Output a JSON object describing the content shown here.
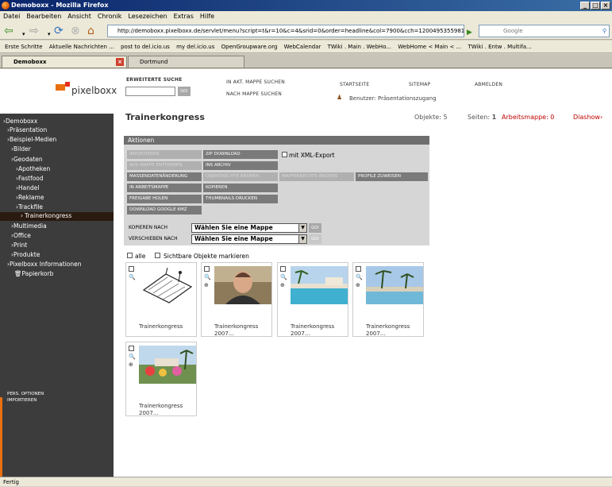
{
  "window": {
    "title": "Demoboxx - Mozilla Firefox"
  },
  "menu": [
    "Datei",
    "Bearbeiten",
    "Ansicht",
    "Chronik",
    "Lesezeichen",
    "Extras",
    "Hilfe"
  ],
  "nav": {
    "url": "http://demoboxx.pixelboxx.de/servlet/menu?script=t&r=10&c=4&srid=0&order=headline&col=7900&cch=1200495355981&JServSessionIdroot=2",
    "search_placeholder": "Google"
  },
  "bookmarks": [
    "Erste Schritte",
    "Aktuelle Nachrichten ...",
    "post to del.icio.us",
    "my del.icio.us",
    "OpenGroupware.org",
    "WebCalendar",
    "TWiki . Main . WebHo...",
    "WebHome < Main < ...",
    "TWiki . Entw . Multifa..."
  ],
  "tabs": [
    "Demoboxx",
    "Dortmund"
  ],
  "header": {
    "logo": "pixelboxx",
    "search_title": "ERWEITERTE SUCHE",
    "go": "GO!",
    "in_mappe": "IN AKT. MAPPE SUCHEN",
    "nach_mappe": "NACH MAPPE SUCHEN",
    "startseite": "STARTSEITE",
    "sitemap": "SITEMAP",
    "abmelden": "ABMELDEN",
    "user": "Benutzer: Präsentationszugang"
  },
  "sidebar": {
    "items": [
      "Demoboxx",
      "Präsentation",
      "Beispiel-Medien",
      "Bilder",
      "Geodaten",
      "Apotheken",
      "Fastfood",
      "Handel",
      "Reklame",
      "Trackfile",
      "Trainerkongress",
      "Multimedia",
      "Office",
      "Print",
      "Produkte",
      "Pixelboxx Informationen",
      "Papierkorb"
    ],
    "pers": "PERS. OPTIONEN",
    "import": "IMPORTIEREN"
  },
  "main": {
    "title": "Trainerkongress",
    "objekte": "Objekte: 5",
    "seiten_label": "Seiten:",
    "seiten": "1",
    "arbeitsmappe": "Arbeitsmappe: 0",
    "diashow": "Diashow›"
  },
  "actions": {
    "header": "Aktionen",
    "buttons": [
      "IMPORTIEREN",
      "ZIP DOWNLOAD",
      "AUS MAPPE ENTFERNEN",
      "INS ARCHIV",
      "MASSENDATENÄNDERUNG",
      "OBJEKTRECHTE ÄNDERN",
      "MAPPENRECHTE ÄNDERN",
      "PROFILE ZUWEISEN",
      "IN ARBEITSMAPPE",
      "KOPIEREN",
      "FREIGABE HOLEN",
      "THUMBNAILS DRUCKEN",
      "DOWNLOAD GOOGLE KMZ"
    ],
    "xml": "mit XML-Export",
    "kopieren_label": "KOPIEREN NACH",
    "verschieben_label": "VERSCHIEBEN NACH",
    "select_value": "Wählen Sie eine Mappe",
    "go": "GO!"
  },
  "selection": {
    "alle": "alle",
    "sichtbare": "Sichtbare Objekte markieren"
  },
  "items": [
    {
      "caption": "Trainerkongress"
    },
    {
      "caption": "Trainerkongress 2007..."
    },
    {
      "caption": "Trainerkongress 2007..."
    },
    {
      "caption": "Trainerkongress 2007..."
    },
    {
      "caption": "Trainerkongress 2007..."
    }
  ],
  "status": "Fertig"
}
